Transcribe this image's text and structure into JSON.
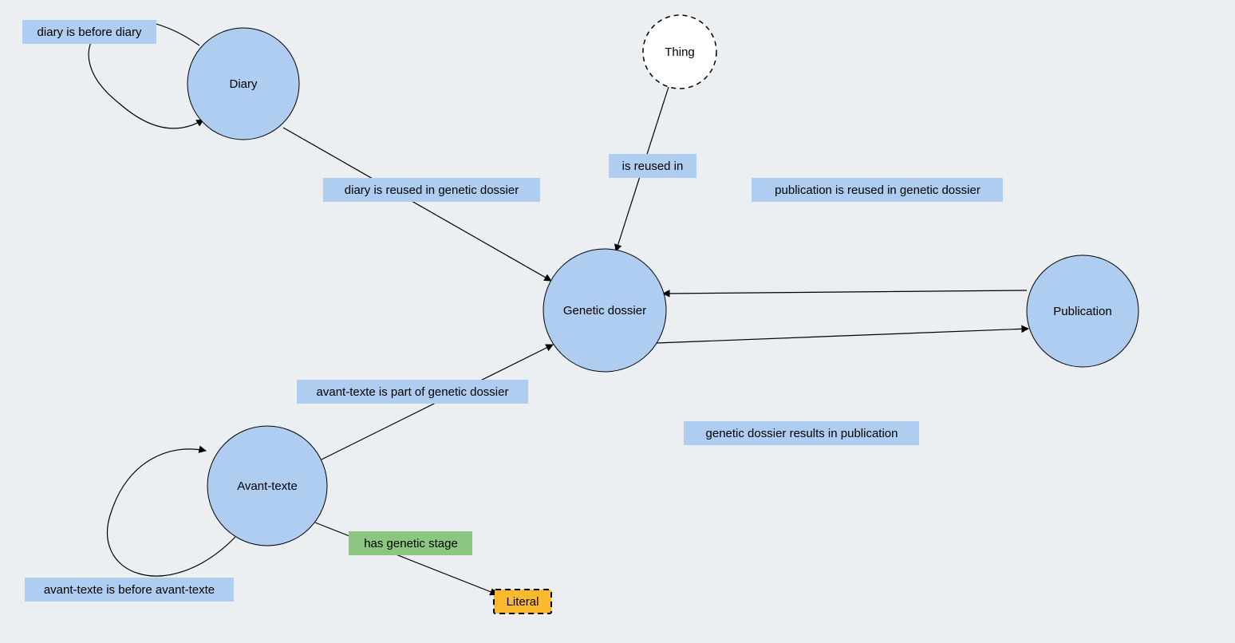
{
  "nodes": {
    "diary": "Diary",
    "thing": "Thing",
    "genetic_dossier": "Genetic dossier",
    "publication": "Publication",
    "avant_texte": "Avant-texte",
    "literal": "Literal"
  },
  "edges": {
    "diary_before_diary": "diary is before diary",
    "diary_reused_in_gd": "diary is reused in genetic dossier",
    "is_reused_in": "is reused in",
    "pub_reused_in_gd": "publication is reused in genetic dossier",
    "at_part_of_gd": "avant-texte is part of genetic dossier",
    "gd_results_pub": "genetic dossier results in publication",
    "at_before_at": "avant-texte is before avant-texte",
    "has_genetic_stage": "has genetic stage"
  }
}
